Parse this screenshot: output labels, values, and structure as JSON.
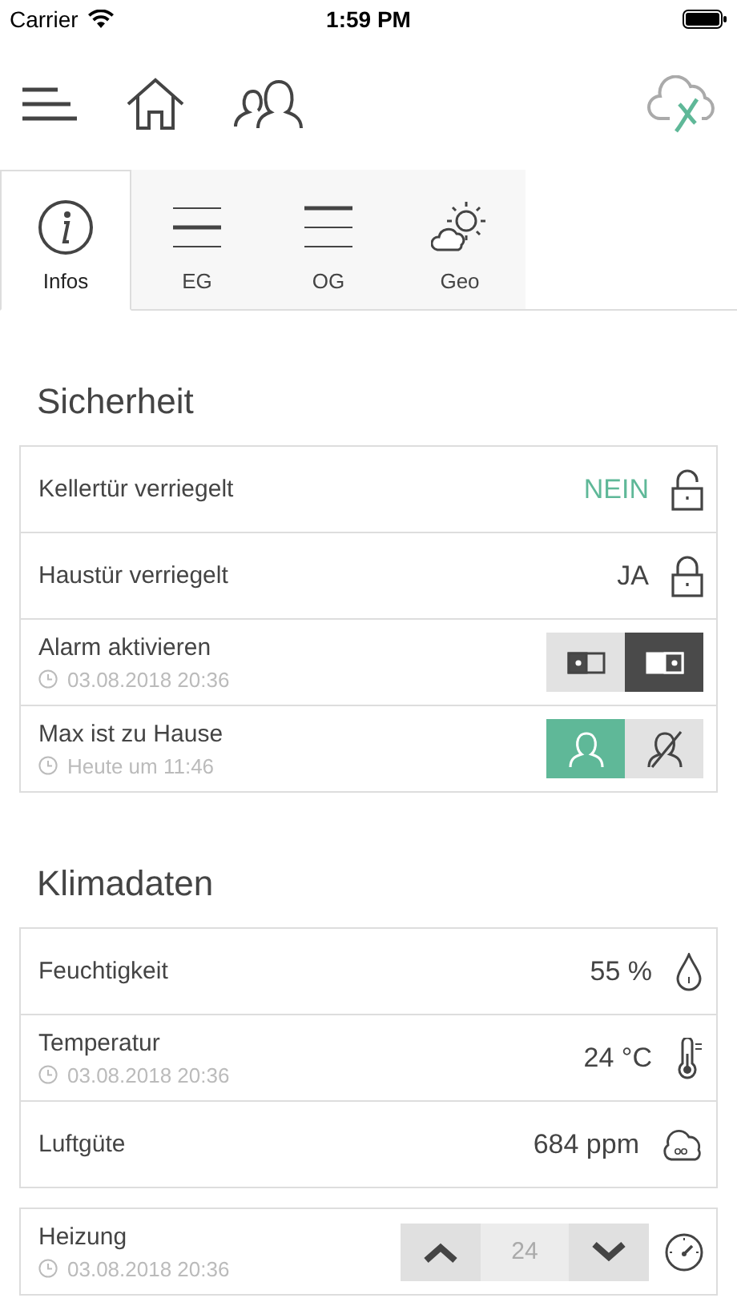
{
  "status_bar": {
    "carrier": "Carrier",
    "time": "1:59 PM"
  },
  "tabs": [
    {
      "label": "Infos",
      "kind": "info",
      "selected": true
    },
    {
      "label": "EG",
      "kind": "ground_floor",
      "selected": false
    },
    {
      "label": "OG",
      "kind": "upper_floor",
      "selected": false
    },
    {
      "label": "Geo",
      "kind": "weather",
      "selected": false
    }
  ],
  "sections": [
    {
      "title": "Sicherheit",
      "groups": [
        [
          {
            "kind": "lock",
            "label": "Kellertür verriegelt",
            "value": "NEIN",
            "locked": false
          },
          {
            "kind": "lock",
            "label": "Haustür verriegelt",
            "value": "JA",
            "locked": true
          },
          {
            "kind": "alarm",
            "label": "Alarm aktivieren",
            "time": "03.08.2018 20:36",
            "options": [
              {
                "selected": false
              },
              {
                "selected": true
              }
            ]
          },
          {
            "kind": "presence",
            "label": "Max ist zu Hause",
            "time": "Heute um 11:46",
            "options": [
              {
                "selected": true
              },
              {
                "selected": false
              }
            ]
          }
        ]
      ]
    },
    {
      "title": "Klimadaten",
      "groups": [
        [
          {
            "kind": "humidity",
            "label": "Feuchtigkeit",
            "value": "55 %"
          },
          {
            "kind": "temperature",
            "label": "Temperatur",
            "time": "03.08.2018 20:36",
            "value": "24 °C"
          },
          {
            "kind": "air",
            "label": "Luftgüte",
            "value": "684 ppm"
          }
        ],
        [
          {
            "kind": "heating",
            "label": "Heizung",
            "time": "03.08.2018 20:36",
            "value": "24"
          }
        ]
      ]
    }
  ]
}
